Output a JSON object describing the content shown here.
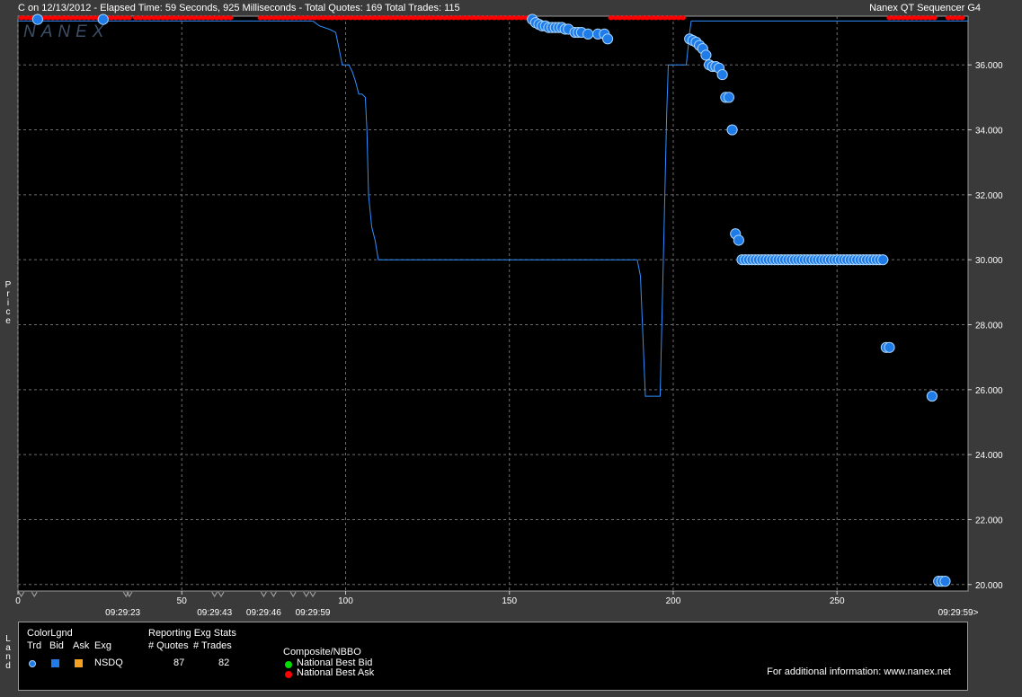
{
  "header": {
    "left": "C on 12/13/2012  -  Elapsed Time: 59 Seconds, 925 Milliseconds  -  Total Quotes: 169  Total Trades: 115",
    "right": "Nanex QT Sequencer G4",
    "watermark": "NANEX"
  },
  "side_labels": {
    "price": "Price",
    "land": "Land"
  },
  "colors": {
    "trade": "#1e7be8",
    "line": "#2f8fff",
    "ask": "#ff0000",
    "bid": "#00dd00",
    "grid": "#6e6e6e"
  },
  "chart_data": {
    "type": "scatter",
    "xlim": [
      0,
      290
    ],
    "ylim": [
      19.8,
      37.5
    ],
    "x_ticks": [
      0,
      50,
      100,
      150,
      200,
      250
    ],
    "y_ticks": [
      "20.000",
      "22.000",
      "24.000",
      "26.000",
      "28.000",
      "30.000",
      "32.000",
      "34.000",
      "36.000"
    ],
    "time_labels": [
      {
        "x": 32,
        "label": "09:29:23"
      },
      {
        "x": 60,
        "label": "09:29:43"
      },
      {
        "x": 75,
        "label": "09:29:46"
      },
      {
        "x": 90,
        "label": "09:29:59"
      },
      {
        "x": 287,
        "label": "09:29:59>"
      }
    ],
    "trades": [
      [
        6,
        37.4
      ],
      [
        26,
        37.4
      ],
      [
        157,
        37.4
      ],
      [
        158,
        37.3
      ],
      [
        159,
        37.25
      ],
      [
        160,
        37.2
      ],
      [
        161,
        37.2
      ],
      [
        162,
        37.15
      ],
      [
        163,
        37.15
      ],
      [
        164,
        37.15
      ],
      [
        165,
        37.15
      ],
      [
        166,
        37.15
      ],
      [
        167,
        37.1
      ],
      [
        168,
        37.1
      ],
      [
        170,
        37.0
      ],
      [
        171,
        37.0
      ],
      [
        172,
        37.0
      ],
      [
        174,
        36.95
      ],
      [
        177,
        36.95
      ],
      [
        179,
        36.95
      ],
      [
        180,
        36.8
      ],
      [
        205,
        36.8
      ],
      [
        206,
        36.75
      ],
      [
        207,
        36.7
      ],
      [
        208,
        36.6
      ],
      [
        209,
        36.5
      ],
      [
        210,
        36.3
      ],
      [
        211,
        36.0
      ],
      [
        212,
        35.95
      ],
      [
        213,
        35.95
      ],
      [
        214,
        35.9
      ],
      [
        215,
        35.7
      ],
      [
        216,
        35.0
      ],
      [
        217,
        35.0
      ],
      [
        218,
        34.0
      ],
      [
        219,
        30.8
      ],
      [
        220,
        30.6
      ],
      [
        221,
        30.0
      ],
      [
        222,
        30.0
      ],
      [
        223,
        30.0
      ],
      [
        224,
        30.0
      ],
      [
        225,
        30.0
      ],
      [
        226,
        30.0
      ],
      [
        227,
        30.0
      ],
      [
        228,
        30.0
      ],
      [
        229,
        30.0
      ],
      [
        230,
        30.0
      ],
      [
        231,
        30.0
      ],
      [
        232,
        30.0
      ],
      [
        233,
        30.0
      ],
      [
        234,
        30.0
      ],
      [
        235,
        30.0
      ],
      [
        236,
        30.0
      ],
      [
        237,
        30.0
      ],
      [
        238,
        30.0
      ],
      [
        239,
        30.0
      ],
      [
        240,
        30.0
      ],
      [
        241,
        30.0
      ],
      [
        242,
        30.0
      ],
      [
        243,
        30.0
      ],
      [
        244,
        30.0
      ],
      [
        245,
        30.0
      ],
      [
        246,
        30.0
      ],
      [
        247,
        30.0
      ],
      [
        248,
        30.0
      ],
      [
        249,
        30.0
      ],
      [
        250,
        30.0
      ],
      [
        251,
        30.0
      ],
      [
        252,
        30.0
      ],
      [
        253,
        30.0
      ],
      [
        254,
        30.0
      ],
      [
        255,
        30.0
      ],
      [
        256,
        30.0
      ],
      [
        257,
        30.0
      ],
      [
        258,
        30.0
      ],
      [
        259,
        30.0
      ],
      [
        260,
        30.0
      ],
      [
        261,
        30.0
      ],
      [
        262,
        30.0
      ],
      [
        263,
        30.0
      ],
      [
        264,
        30.0
      ],
      [
        265,
        27.3
      ],
      [
        266,
        27.3
      ],
      [
        279,
        25.8
      ],
      [
        281,
        20.1
      ],
      [
        282,
        20.1
      ],
      [
        283,
        20.1
      ]
    ],
    "price_line": [
      [
        0,
        37.35
      ],
      [
        58,
        37.35
      ],
      [
        90,
        37.35
      ],
      [
        92,
        37.2
      ],
      [
        95,
        37.1
      ],
      [
        97,
        37.0
      ],
      [
        98,
        36.5
      ],
      [
        99,
        36.0
      ],
      [
        101,
        36.0
      ],
      [
        102,
        35.8
      ],
      [
        103,
        35.5
      ],
      [
        104,
        35.1
      ],
      [
        105,
        35.1
      ],
      [
        106,
        35.0
      ],
      [
        106.5,
        34.0
      ],
      [
        107,
        32.0
      ],
      [
        108,
        31.0
      ],
      [
        109,
        30.6
      ],
      [
        110,
        30.0
      ],
      [
        189,
        30.0
      ],
      [
        190,
        29.5
      ],
      [
        191,
        27.0
      ],
      [
        191.5,
        25.8
      ],
      [
        196,
        25.8
      ],
      [
        197,
        30.0
      ],
      [
        198,
        34.5
      ],
      [
        198.5,
        36.0
      ],
      [
        203,
        36.0
      ],
      [
        204,
        36.0
      ],
      [
        204.5,
        36.5
      ],
      [
        205,
        37.0
      ],
      [
        205.5,
        37.35
      ],
      [
        290,
        37.35
      ]
    ],
    "ask_ranges": [
      [
        0,
        37.45
      ],
      [
        1,
        35
      ],
      [
        36,
        65
      ],
      [
        74,
        157
      ],
      [
        181,
        204
      ],
      [
        266,
        280
      ],
      [
        284,
        289
      ]
    ]
  },
  "legend": {
    "color_legend_title": "ColorLgnd",
    "trd": "Trd",
    "bid": "Bid",
    "ask": "Ask",
    "exg": "Exg",
    "exchange": "NSDQ",
    "reporting_title": "Reporting Exg Stats",
    "quotes_header": "# Quotes",
    "trades_header": "# Trades",
    "quotes_value": "87",
    "trades_value": "82",
    "composite_title": "Composite/NBBO",
    "national_best_bid": "National Best Bid",
    "national_best_ask": "National Best Ask",
    "additional_info": "For additional information: www.nanex.net"
  }
}
